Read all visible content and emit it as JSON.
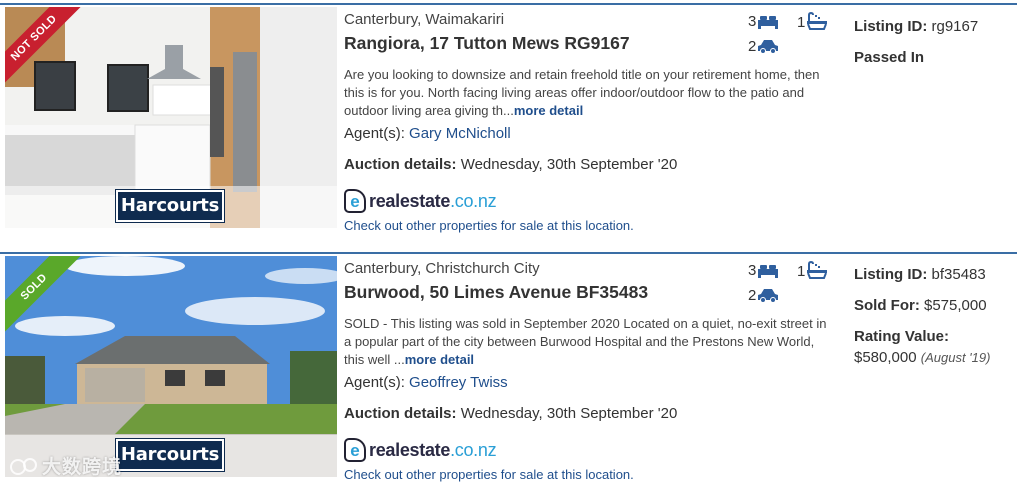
{
  "listings": [
    {
      "ribbon": "NOT SOLD",
      "ribbon_color": "#c8202f",
      "agency_logo": "Harcourts",
      "region": "Canterbury, Waimakariri",
      "address": "Rangiora, 17 Tutton Mews RG9167",
      "description": "Are you looking to downsize and retain freehold title on your retirement home, then this is for you. North facing living areas offer indoor/outdoor flow to the patio and outdoor living area giving th...",
      "more_label": "more detail",
      "agents_label": "Agent(s):",
      "agent_name": "Gary McNicholl",
      "auction_label": "Auction details:",
      "auction_value": "Wednesday, 30th September '20",
      "portal_logo_badge": "e",
      "portal_logo_name": "realestate",
      "portal_logo_tld": ".co.nz",
      "check_link": "Check out other properties for sale at this location.",
      "bedrooms": "3",
      "bathrooms": "1",
      "garages": "2",
      "listing_id_label": "Listing ID:",
      "listing_id": "rg9167",
      "status": "Passed In"
    },
    {
      "ribbon": "SOLD",
      "ribbon_color": "#5aa82a",
      "agency_logo": "Harcourts",
      "region": "Canterbury, Christchurch City",
      "address": "Burwood, 50 Limes Avenue BF35483",
      "description": "SOLD - This listing was sold in September 2020 Located on a quiet, no-exit street in a popular part of the city between Burwood Hospital and the Prestons New World, this well ...",
      "more_label": "more detail",
      "agents_label": "Agent(s):",
      "agent_name": "Geoffrey Twiss",
      "auction_label": "Auction details:",
      "auction_value": "Wednesday, 30th September '20",
      "portal_logo_badge": "e",
      "portal_logo_name": "realestate",
      "portal_logo_tld": ".co.nz",
      "check_link": "Check out other properties for sale at this location.",
      "bedrooms": "3",
      "bathrooms": "1",
      "garages": "2",
      "listing_id_label": "Listing ID:",
      "listing_id": "bf35483",
      "sold_for_label": "Sold For:",
      "sold_for": "$575,000",
      "rating_value_label": "Rating Value:",
      "rating_value": "$580,000",
      "rating_date": "(August '19)"
    }
  ],
  "watermark": "大数跨境",
  "icons": [
    "bed-icon",
    "bath-icon",
    "car-icon"
  ],
  "colors": {
    "link": "#1f4e8c",
    "divider": "#3a6ea5",
    "icon": "#2f5f9e"
  }
}
